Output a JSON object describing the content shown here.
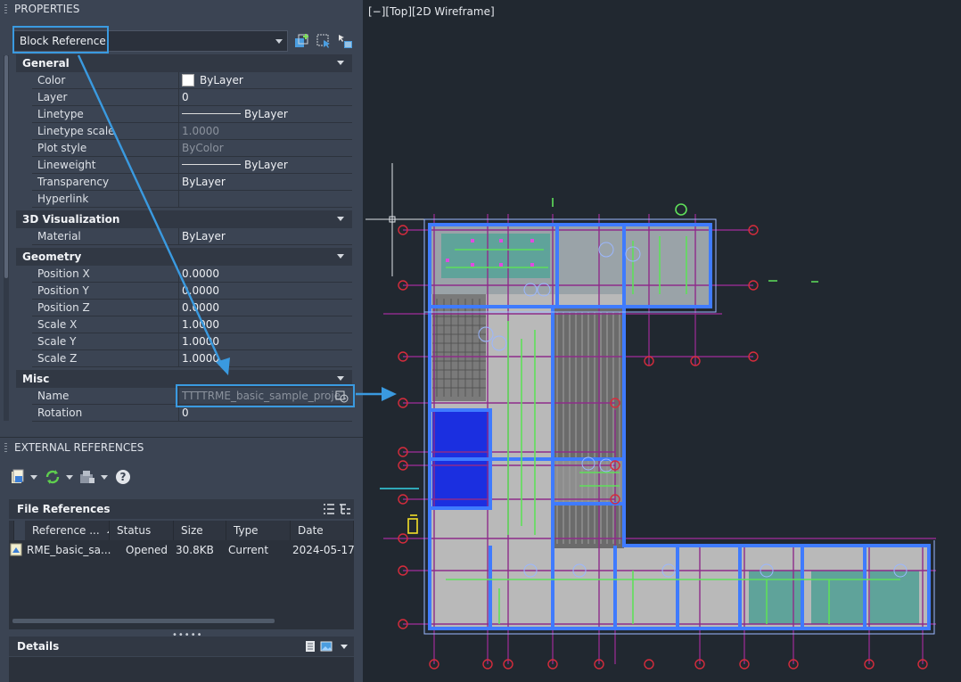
{
  "properties": {
    "title": "PROPERTIES",
    "selection": "Block Reference",
    "sections": [
      {
        "name": "General",
        "rows": [
          {
            "key": "Color",
            "value": "ByLayer"
          },
          {
            "key": "Layer",
            "value": "0"
          },
          {
            "key": "Linetype",
            "value": "ByLayer"
          },
          {
            "key": "Linetype scale",
            "value": "1.0000"
          },
          {
            "key": "Plot style",
            "value": "ByColor"
          },
          {
            "key": "Lineweight",
            "value": "ByLayer"
          },
          {
            "key": "Transparency",
            "value": "ByLayer"
          },
          {
            "key": "Hyperlink",
            "value": ""
          }
        ]
      },
      {
        "name": "3D Visualization",
        "rows": [
          {
            "key": "Material",
            "value": "ByLayer"
          }
        ]
      },
      {
        "name": "Geometry",
        "rows": [
          {
            "key": "Position X",
            "value": "0.0000"
          },
          {
            "key": "Position Y",
            "value": "0.0000"
          },
          {
            "key": "Position Z",
            "value": "0.0000"
          },
          {
            "key": "Scale X",
            "value": "1.0000"
          },
          {
            "key": "Scale Y",
            "value": "1.0000"
          },
          {
            "key": "Scale Z",
            "value": "1.0000"
          }
        ]
      },
      {
        "name": "Misc",
        "rows": [
          {
            "key": "Name",
            "value": "TTTTRME_basic_sample_project-..."
          },
          {
            "key": "Rotation",
            "value": "0"
          }
        ]
      }
    ]
  },
  "xref": {
    "title": "EXTERNAL REFERENCES",
    "file_references_label": "File References",
    "columns": [
      "Reference ...",
      "Status",
      "Size",
      "Type",
      "Date"
    ],
    "rows": [
      {
        "reference": "RME_basic_sa...",
        "status": "Opened",
        "size": "30.8KB",
        "type": "Current",
        "date": "2024-05-17"
      }
    ],
    "details_label": "Details",
    "help_glyph": "?"
  },
  "viewport": {
    "label": "[−][Top][2D Wireframe]"
  },
  "colors": {
    "panel_bg": "#3b4453",
    "viewport_bg": "#212830",
    "highlight": "#3a9ae0",
    "grid_line": "#8e2c8a",
    "grid_bubble": "#d62c3c",
    "wall": "#3f7bff",
    "room_fill": "#c8c8c8"
  }
}
